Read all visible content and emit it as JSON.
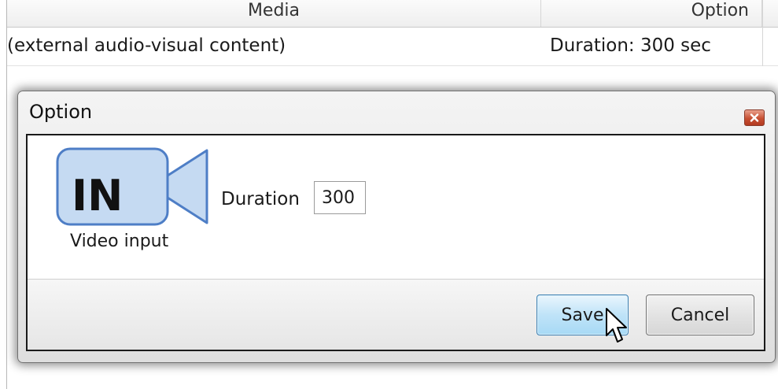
{
  "table": {
    "columns": [
      "Media",
      "Option"
    ],
    "row": {
      "media": "(external audio-visual content)",
      "option": "Duration: 300 sec"
    }
  },
  "dialog": {
    "title": "Option",
    "close_icon": "close-icon",
    "input_icon": {
      "icon": "video-camera-icon",
      "badge_text": "IN",
      "label": "Video input"
    },
    "duration": {
      "label": "Duration",
      "value": "300"
    },
    "buttons": {
      "save_label": "Save",
      "cancel_label": "Cancel"
    }
  },
  "colors": {
    "camera_fill": "#c5daf2",
    "camera_stroke": "#4e7ec6",
    "save_button": "#bfe3f8",
    "close_button": "#c75033"
  }
}
